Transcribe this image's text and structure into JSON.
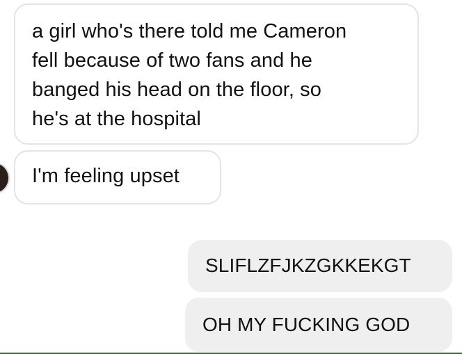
{
  "messages": [
    {
      "direction": "incoming",
      "lines": [
        "a girl who's there told me Cameron",
        "fell because of two fans and he",
        "banged his head on the floor, so",
        "he's at the hospital"
      ]
    },
    {
      "direction": "incoming",
      "lines": [
        "I'm feeling upset"
      ]
    },
    {
      "direction": "outgoing",
      "lines": [
        "SLIFLZFJKZGKKEKGT"
      ]
    },
    {
      "direction": "outgoing",
      "lines": [
        "OH MY FUCKING GOD"
      ]
    }
  ],
  "colors": {
    "incoming_bubble": "#ffffff",
    "incoming_border": "#e4e4e4",
    "outgoing_bubble": "#efefef",
    "text": "#111111"
  }
}
